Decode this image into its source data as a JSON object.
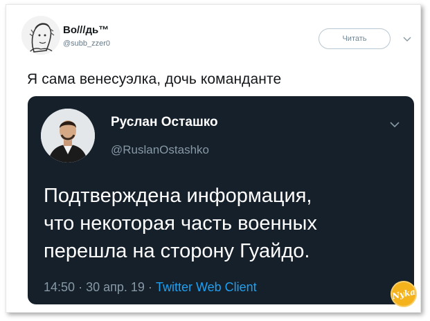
{
  "tweet": {
    "author_name": "Во///дь™",
    "author_handle": "@subb_zzer0",
    "follow_label": "Читать",
    "text": "Я сама венесуэлка, дочь команданте"
  },
  "quoted_tweet": {
    "author_name": "Руслан Осташко",
    "author_handle": "@RuslanOstashko",
    "body_lines": [
      "Подтверждена информация,",
      "что некоторая часть военных",
      "перешла на сторону Гуайдо."
    ],
    "time": "14:50",
    "date": "30 апр. 19",
    "separator": "·",
    "source": "Twitter Web Client"
  },
  "colors": {
    "quote_background": "#15202b",
    "link_blue": "#1da1f2",
    "muted_gray": "#8899a6",
    "watermark_orange": "#f4b21d"
  },
  "icons": {
    "menu": "chevron-down-icon",
    "quote_menu": "chevron-down-icon"
  }
}
